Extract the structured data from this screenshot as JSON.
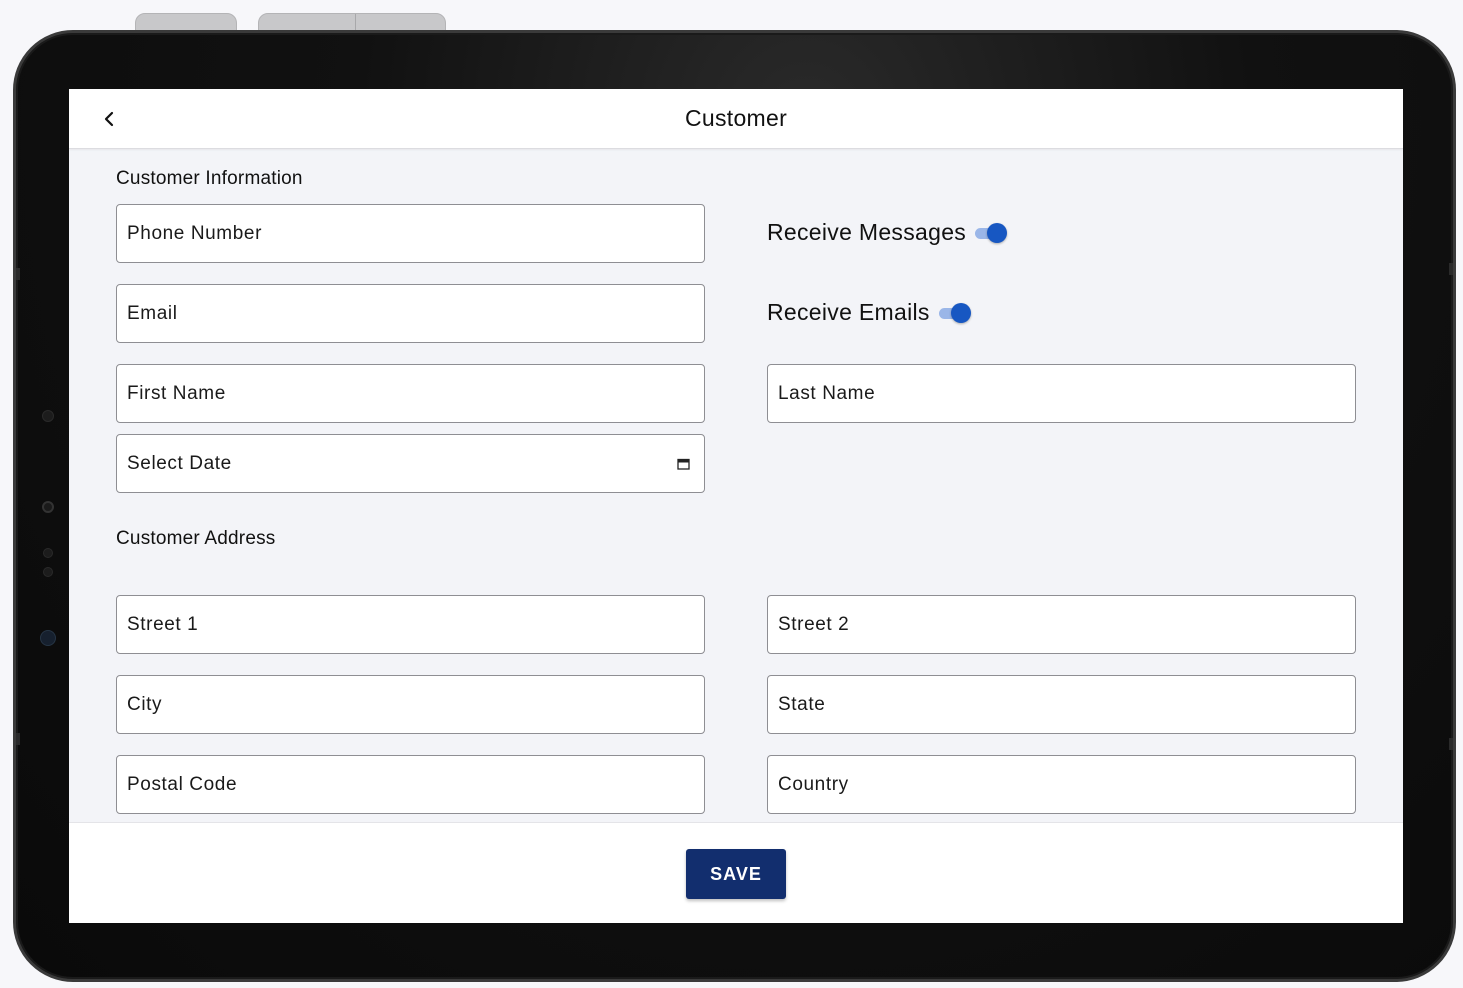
{
  "header": {
    "title": "Customer",
    "back_icon": "chevron-left-icon"
  },
  "customer_information": {
    "section_title": "Customer Information",
    "phone_placeholder": "Phone Number",
    "email_placeholder": "Email",
    "first_name_placeholder": "First Name",
    "last_name_placeholder": "Last Name",
    "date_placeholder": "Select Date",
    "date_icon": "calendar-icon",
    "receive_messages": {
      "label": "Receive Messages",
      "on": true
    },
    "receive_emails": {
      "label": "Receive Emails",
      "on": true
    }
  },
  "customer_address": {
    "section_title": "Customer Address",
    "street1_placeholder": "Street 1",
    "street2_placeholder": "Street 2",
    "city_placeholder": "City",
    "state_placeholder": "State",
    "postal_code_placeholder": "Postal Code",
    "country_placeholder": "Country"
  },
  "footer": {
    "save_label": "SAVE"
  },
  "colors": {
    "accent": "#1757c2",
    "save_button": "#122e6e"
  }
}
